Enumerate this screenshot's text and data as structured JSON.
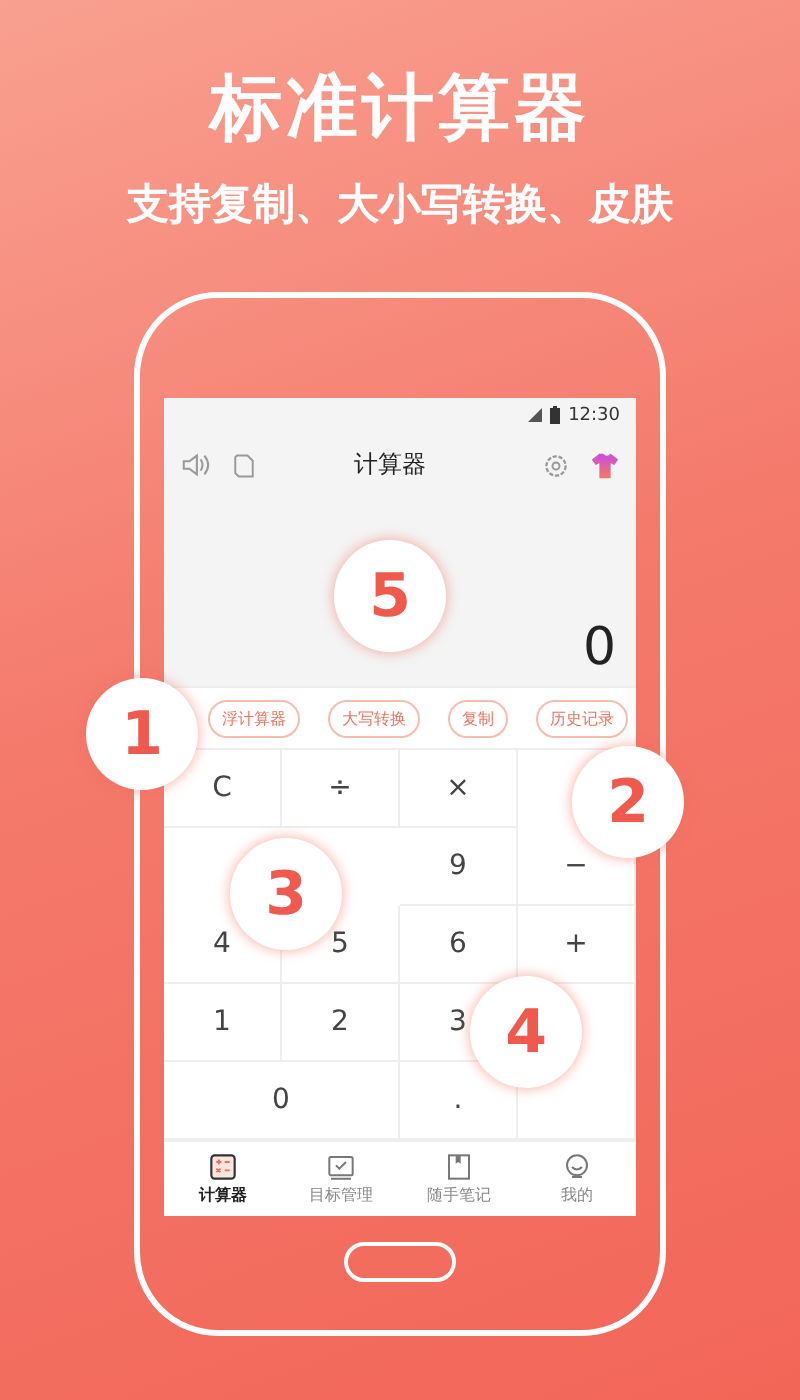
{
  "headline": "标准计算器",
  "subheadline": "支持复制、大小写转换、皮肤",
  "status_bar": {
    "time": "12:30"
  },
  "app_bar": {
    "title": "计算器"
  },
  "display": {
    "value": "0"
  },
  "chips": [
    {
      "label": "浮计算器"
    },
    {
      "label": "大写转换"
    },
    {
      "label": "复制"
    },
    {
      "label": "历史记录"
    }
  ],
  "keypad": [
    {
      "kind": "key",
      "label": "C"
    },
    {
      "kind": "key",
      "label": "÷"
    },
    {
      "kind": "key",
      "label": "×"
    },
    {
      "kind": "blank"
    },
    {
      "kind": "blank"
    },
    {
      "kind": "blank"
    },
    {
      "kind": "key",
      "label": "9"
    },
    {
      "kind": "key",
      "label": "−"
    },
    {
      "kind": "key",
      "label": "4"
    },
    {
      "kind": "key",
      "label": "5"
    },
    {
      "kind": "key",
      "label": "6"
    },
    {
      "kind": "key",
      "label": "+"
    },
    {
      "kind": "key",
      "label": "1"
    },
    {
      "kind": "key",
      "label": "2"
    },
    {
      "kind": "key",
      "label": "3"
    },
    {
      "kind": "tall"
    },
    {
      "kind": "wide",
      "label": "0"
    },
    {
      "kind": "key",
      "label": "."
    }
  ],
  "tabs": [
    {
      "label": "计算器",
      "selected": true
    },
    {
      "label": "目标管理",
      "selected": false
    },
    {
      "label": "随手笔记",
      "selected": false
    },
    {
      "label": "我的",
      "selected": false
    }
  ],
  "callouts": [
    "1",
    "2",
    "3",
    "4",
    "5"
  ]
}
